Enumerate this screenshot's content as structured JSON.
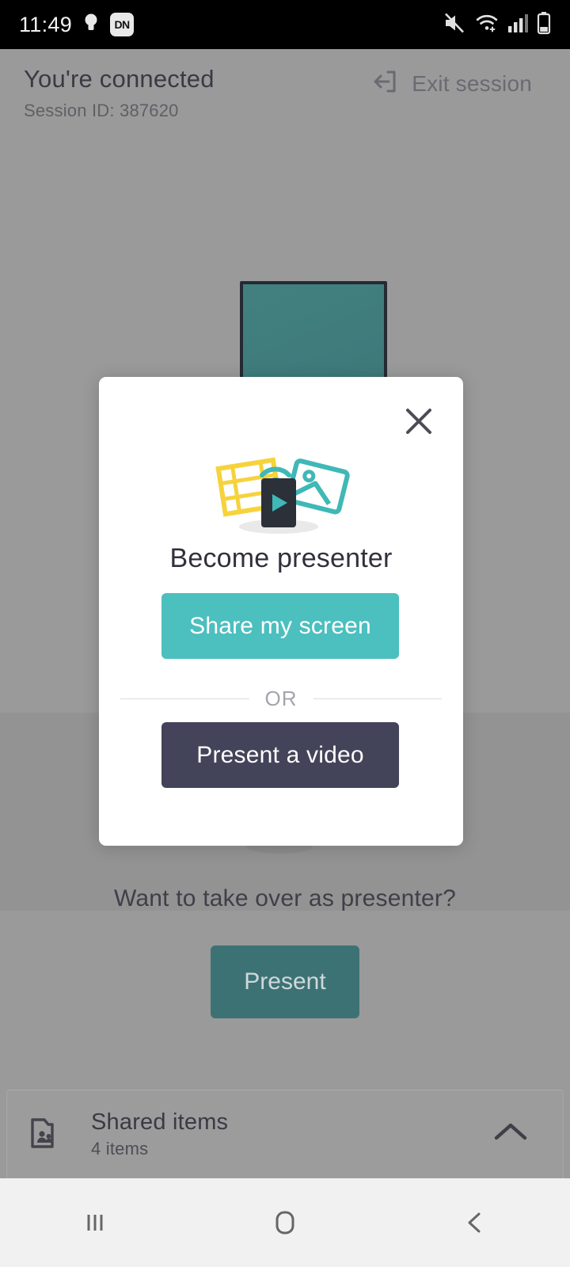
{
  "status_bar": {
    "time": "11:49",
    "left_icons": [
      "flashlight-icon",
      "do-not-disturb-badge"
    ],
    "dnd_badge_label": "DN",
    "right_icons": [
      "mute-icon",
      "wifi-icon",
      "cellular-signal-icon",
      "battery-icon"
    ]
  },
  "header": {
    "title": "You're connected",
    "session_label": "Session ID: 387620",
    "exit_label": "Exit session",
    "exit_icon": "exit-session-icon"
  },
  "background": {
    "illustration_name": "tv-and-laptop-casting-illustration",
    "tv_color": "#3d7b7d",
    "outline_color": "#252a33"
  },
  "takeover": {
    "prompt": "Want to take over as presenter?",
    "present_label": "Present"
  },
  "shared_items": {
    "icon": "shared-folder-icon",
    "title": "Shared items",
    "count_label": "4 items",
    "chevron_icon": "chevron-up-icon"
  },
  "modal": {
    "close_icon": "close-icon",
    "illustration_name": "media-cast-illustration",
    "title": "Become presenter",
    "primary_label": "Share my screen",
    "divider_label": "OR",
    "secondary_label": "Present a video",
    "primary_color": "#4cbfbf",
    "secondary_color": "#434459"
  },
  "nav_bar": {
    "recents_icon": "recents-icon",
    "home_icon": "home-icon",
    "back_icon": "back-icon"
  }
}
